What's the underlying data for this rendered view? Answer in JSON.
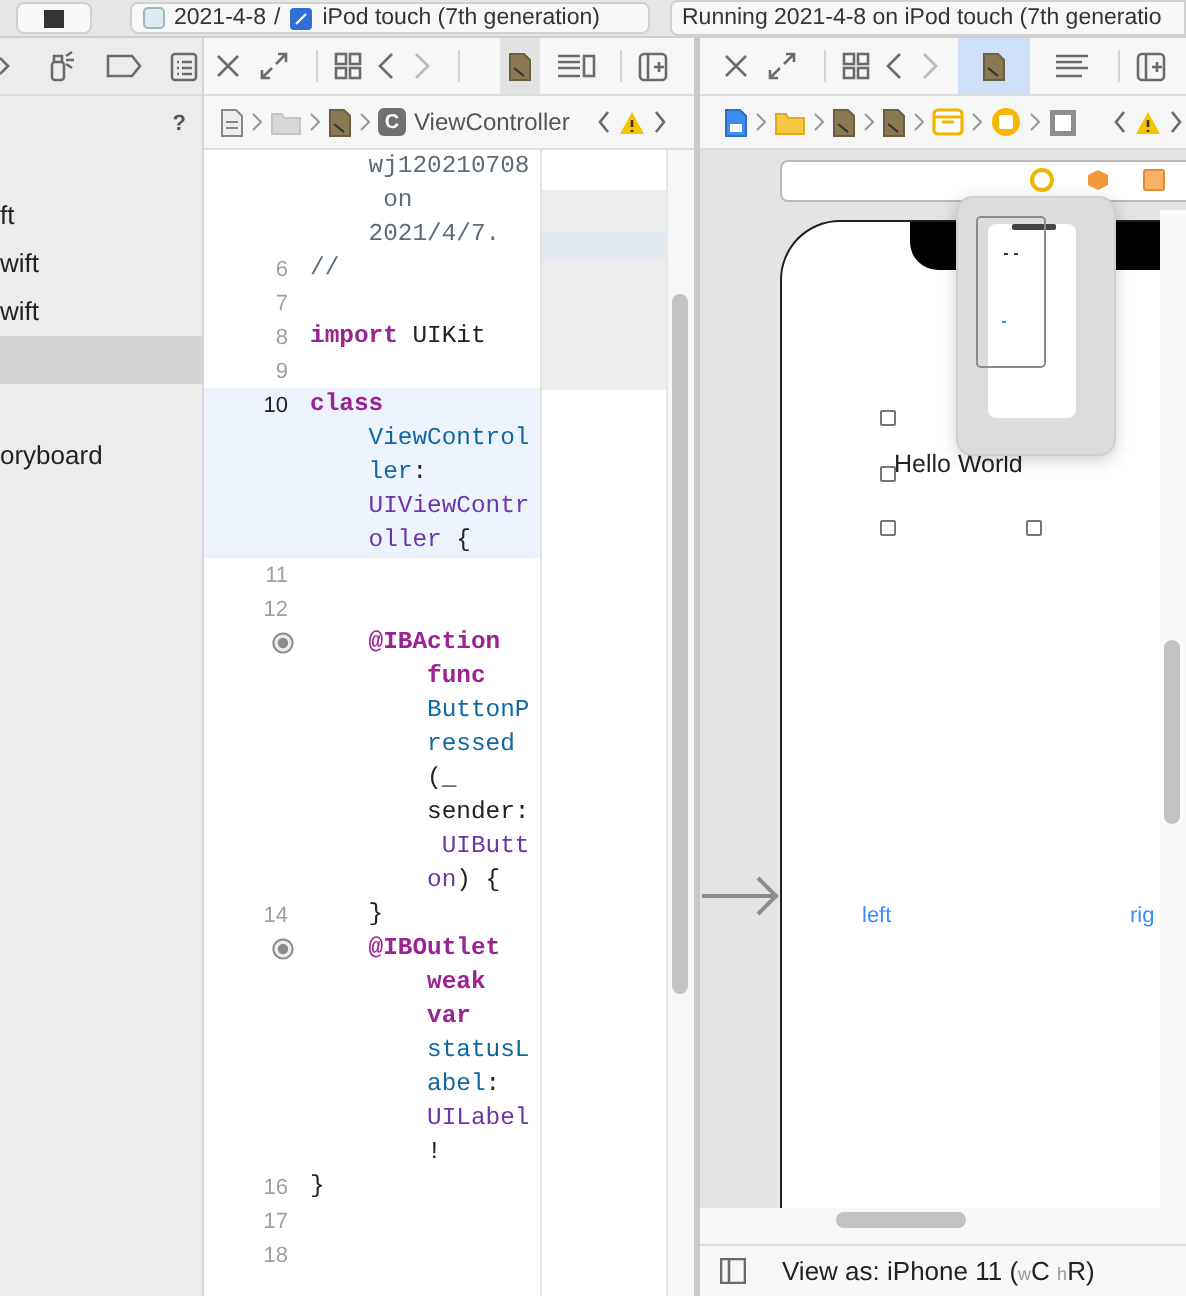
{
  "toolbar": {
    "scheme": "2021-4-8",
    "separator": "/",
    "destination": "iPod touch (7th generation)",
    "activity": "Running 2021-4-8 on iPod touch (7th generatio"
  },
  "navigator": {
    "help": "?",
    "items": [
      {
        "label": "ft",
        "selected": false
      },
      {
        "label": "wift",
        "selected": false
      },
      {
        "label": "wift",
        "selected": false
      },
      {
        "selected": true
      },
      {
        "label": "oryboard",
        "selected": false
      }
    ]
  },
  "editor": {
    "breadcrumb": {
      "title": "ViewController",
      "badge": "C"
    },
    "lines": [
      {
        "continued": true,
        "rows": [
          {
            "parts": [
              {
                "text": "wj120210708",
                "kind": "comment"
              }
            ]
          },
          {
            "parts": [
              {
                "text": " on",
                "kind": "comment"
              }
            ]
          },
          {
            "parts": [
              {
                "text": "2021/4/7.",
                "kind": "comment"
              }
            ]
          }
        ]
      },
      {
        "number": "6",
        "rows": [
          {
            "parts": [
              {
                "text": "//",
                "kind": "comment"
              }
            ]
          }
        ]
      },
      {
        "number": "7"
      },
      {
        "number": "8",
        "rows": [
          {
            "parts": [
              {
                "text": "import",
                "kind": "keyword"
              },
              {
                "text": " UIKit",
                "kind": "plain"
              }
            ]
          }
        ]
      },
      {
        "number": "9"
      },
      {
        "number": "10",
        "current": true,
        "rows": [
          {
            "parts": [
              {
                "text": "class",
                "kind": "keyword"
              }
            ]
          },
          {
            "parts": [
              {
                "text": "ViewControl",
                "kind": "decl"
              }
            ]
          },
          {
            "parts": [
              {
                "text": "ler",
                "kind": "decl"
              },
              {
                "text": ":",
                "kind": "plain"
              }
            ]
          },
          {
            "parts": [
              {
                "text": "UIViewContr",
                "kind": "type"
              }
            ]
          },
          {
            "parts": [
              {
                "text": "oller",
                "kind": "type"
              },
              {
                "text": " {",
                "kind": "plain"
              }
            ]
          }
        ]
      },
      {
        "number": "11"
      },
      {
        "number": "12"
      },
      {
        "connected": true,
        "rows": [
          {
            "parts": [
              {
                "text": "    @IBAction",
                "kind": "keyword"
              }
            ]
          },
          {
            "parts": [
              {
                "text": "func",
                "kind": "keyword"
              }
            ]
          },
          {
            "parts": [
              {
                "text": "ButtonP",
                "kind": "decl"
              }
            ]
          },
          {
            "parts": [
              {
                "text": "ressed",
                "kind": "decl"
              }
            ]
          },
          {
            "parts": [
              {
                "text": "(_",
                "kind": "plain"
              }
            ]
          },
          {
            "parts": [
              {
                "text": "sender:",
                "kind": "plain"
              }
            ]
          },
          {
            "parts": [
              {
                "text": " UIButt",
                "kind": "type"
              }
            ]
          },
          {
            "parts": [
              {
                "text": "on",
                "kind": "type"
              },
              {
                "text": ") {",
                "kind": "plain"
              }
            ]
          }
        ]
      },
      {
        "number": "14",
        "rows": [
          {
            "parts": [
              {
                "text": "    }",
                "kind": "plain"
              }
            ]
          }
        ]
      },
      {
        "connected": true,
        "rows": [
          {
            "parts": [
              {
                "text": "    @IBOutlet",
                "kind": "keyword"
              }
            ]
          },
          {
            "parts": [
              {
                "text": "weak",
                "kind": "keyword"
              }
            ]
          },
          {
            "parts": [
              {
                "text": "var",
                "kind": "keyword"
              }
            ]
          },
          {
            "parts": [
              {
                "text": "statusL",
                "kind": "decl"
              }
            ]
          },
          {
            "parts": [
              {
                "text": "abel",
                "kind": "decl"
              },
              {
                "text": ":",
                "kind": "plain"
              }
            ]
          },
          {
            "parts": [
              {
                "text": "UILabel",
                "kind": "type"
              }
            ]
          },
          {
            "parts": [
              {
                "text": "!",
                "kind": "plain"
              }
            ]
          }
        ]
      },
      {
        "number": "16",
        "rows": [
          {
            "parts": [
              {
                "text": "}",
                "kind": "plain"
              }
            ]
          }
        ]
      },
      {
        "number": "17"
      },
      {
        "number": "18"
      }
    ]
  },
  "canvas": {
    "label": "Hello World",
    "buttons": [
      "left",
      "rig"
    ],
    "view_as": "View as: iPhone 11 ($_{w}$C $_{h}$R)"
  }
}
